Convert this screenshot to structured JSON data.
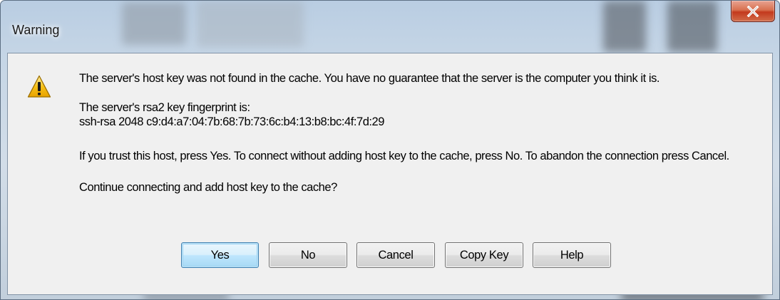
{
  "window": {
    "title": "Warning",
    "close_label": "X"
  },
  "message": {
    "icon": "warning-triangle-icon",
    "line1": "The server's host key was not found in the cache. You have no guarantee that the server is the computer you think it is.",
    "fingerprint_label": "The server's rsa2 key fingerprint is:",
    "fingerprint_value": "ssh-rsa 2048 c9:d4:a7:04:7b:68:7b:73:6c:b4:13:b8:bc:4f:7d:29",
    "instructions": "If you trust this host, press Yes. To connect without adding host key to the cache, press No. To abandon the connection press Cancel.",
    "question": "Continue connecting and add host key to the cache?"
  },
  "buttons": {
    "yes": "Yes",
    "no": "No",
    "cancel": "Cancel",
    "copy_key": "Copy Key",
    "help": "Help"
  },
  "colors": {
    "close_button": "#c3391d",
    "default_button_border": "#3c7fb1",
    "warning_yellow": "#f7c21a"
  }
}
